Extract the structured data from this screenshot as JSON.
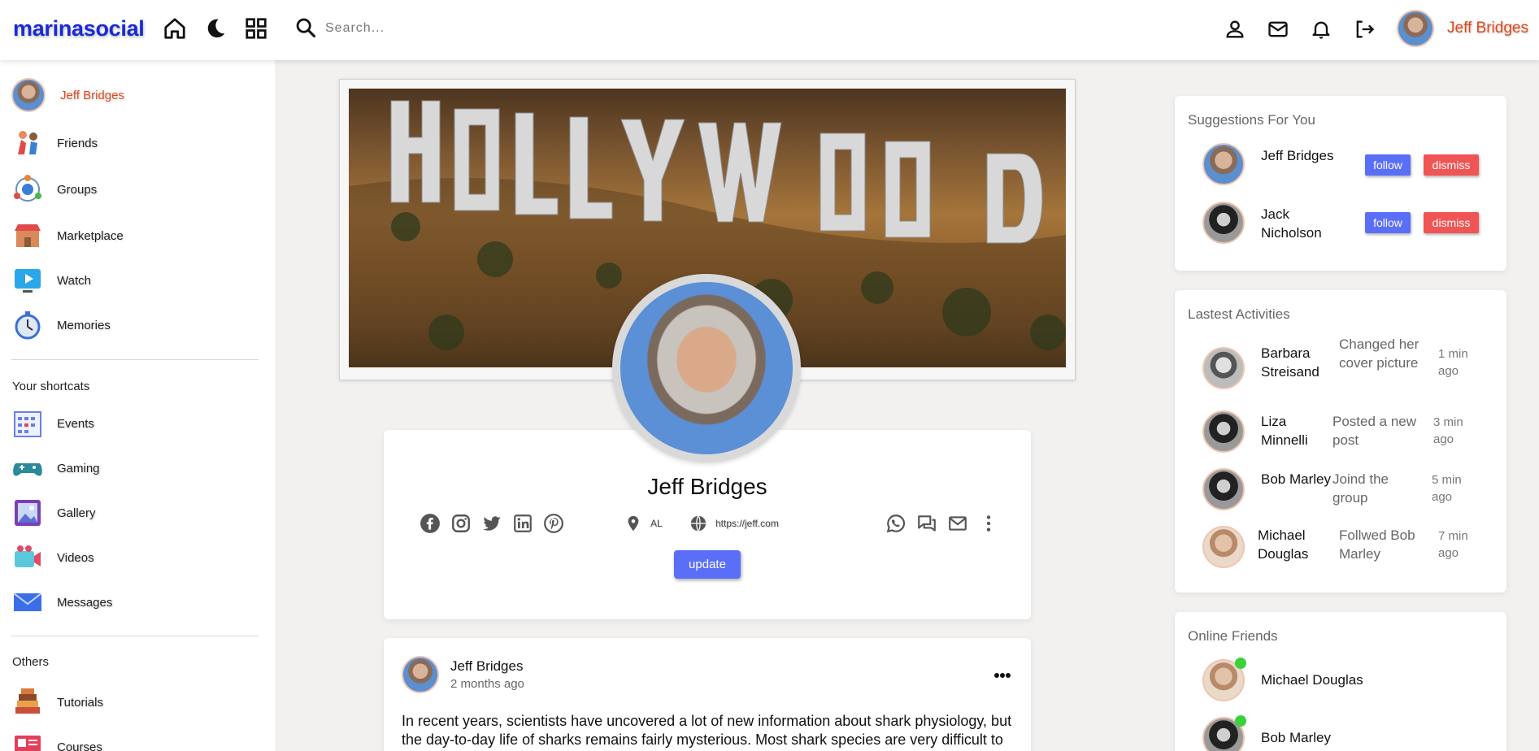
{
  "app": {
    "logo": "marinasocial"
  },
  "search": {
    "placeholder": "Search..."
  },
  "navbar": {
    "user_name": "Jeff Bridges",
    "icons": [
      "home-icon",
      "moon-icon",
      "grid-icon",
      "search-icon",
      "person-icon",
      "mail-icon",
      "bell-icon",
      "logout-icon"
    ]
  },
  "sidebar": {
    "user": "Jeff Bridges",
    "main_items": [
      {
        "label": "Friends",
        "icon": "friends-icon"
      },
      {
        "label": "Groups",
        "icon": "groups-icon"
      },
      {
        "label": "Marketplace",
        "icon": "marketplace-icon"
      },
      {
        "label": "Watch",
        "icon": "watch-icon"
      },
      {
        "label": "Memories",
        "icon": "memories-icon"
      }
    ],
    "shortcuts_title": "Your shortcats",
    "shortcuts": [
      {
        "label": "Events",
        "icon": "events-icon"
      },
      {
        "label": "Gaming",
        "icon": "gaming-icon"
      },
      {
        "label": "Gallery",
        "icon": "gallery-icon"
      },
      {
        "label": "Videos",
        "icon": "videos-icon"
      },
      {
        "label": "Messages",
        "icon": "messages-icon"
      }
    ],
    "others_title": "Others",
    "others": [
      {
        "label": "Tutorials",
        "icon": "tutorials-icon"
      },
      {
        "label": "Courses",
        "icon": "courses-icon"
      }
    ]
  },
  "profile": {
    "name": "Jeff Bridges",
    "location": "AL",
    "website": "https://jeff.com",
    "update_label": "update",
    "social_icons": [
      "facebook-icon",
      "instagram-icon",
      "twitter-icon",
      "linkedin-icon",
      "pinterest-icon"
    ],
    "contact_icons": [
      "whatsapp-icon",
      "chat-icon",
      "mail-icon",
      "more-vertical-icon"
    ]
  },
  "post": {
    "author": "Jeff Bridges",
    "time": "2 months ago",
    "text": "In recent years, scientists have uncovered a lot of new information about shark physiology, but the day-to-day life of sharks remains fairly mysterious. Most shark species are very difficult to"
  },
  "suggestions": {
    "title": "Suggestions For You",
    "follow_label": "follow",
    "dismiss_label": "dismiss",
    "people": [
      {
        "name": "Jeff Bridges"
      },
      {
        "name": "Jack Nicholson"
      }
    ]
  },
  "activities": {
    "title": "Lastest Activities",
    "items": [
      {
        "name": "Barbara Streisand",
        "text": "Changed her cover picture",
        "time": "1 min ago"
      },
      {
        "name": "Liza Minnelli",
        "text": "Posted a new post",
        "time": "3 min ago"
      },
      {
        "name": "Bob Marley",
        "text": "Joind the group",
        "time": "5 min ago"
      },
      {
        "name": "Michael Douglas",
        "text": "Follwed Bob Marley",
        "time": "7 min ago"
      }
    ]
  },
  "online_friends": {
    "title": "Online Friends",
    "items": [
      {
        "name": "Michael Douglas"
      },
      {
        "name": "Bob Marley"
      }
    ]
  },
  "colors": {
    "brand": "#1a2ad6",
    "accent_name": "#e24a1b",
    "primary_button": "#5b6ef7",
    "danger_button": "#f05454",
    "online": "#3ad13a"
  }
}
